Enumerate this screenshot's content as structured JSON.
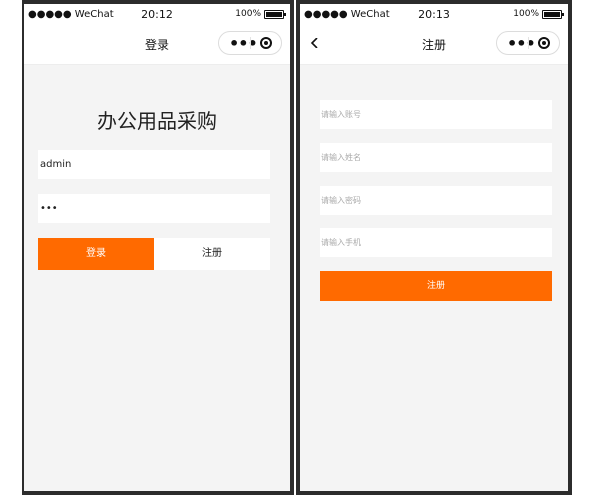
{
  "login_screen": {
    "status": {
      "carrier": "●●●●● WeChat",
      "time": "20:12",
      "battery": "100%"
    },
    "nav_title": "登录",
    "app_title": "办公用品采购",
    "username_value": "admin",
    "password_value": "•••",
    "login_label": "登录",
    "register_label": "注册"
  },
  "register_screen": {
    "status": {
      "carrier": "●●●●● WeChat",
      "time": "20:13",
      "battery": "100%"
    },
    "nav_title": "注册",
    "fields": [
      {
        "placeholder": "请输入账号"
      },
      {
        "placeholder": "请输入姓名"
      },
      {
        "placeholder": "请输入密码"
      },
      {
        "placeholder": "请输入手机"
      }
    ],
    "submit_label": "注册"
  },
  "colors": {
    "accent": "#ff6a00",
    "page_bg": "#f4f4f4",
    "frame": "#2c2c2c"
  }
}
